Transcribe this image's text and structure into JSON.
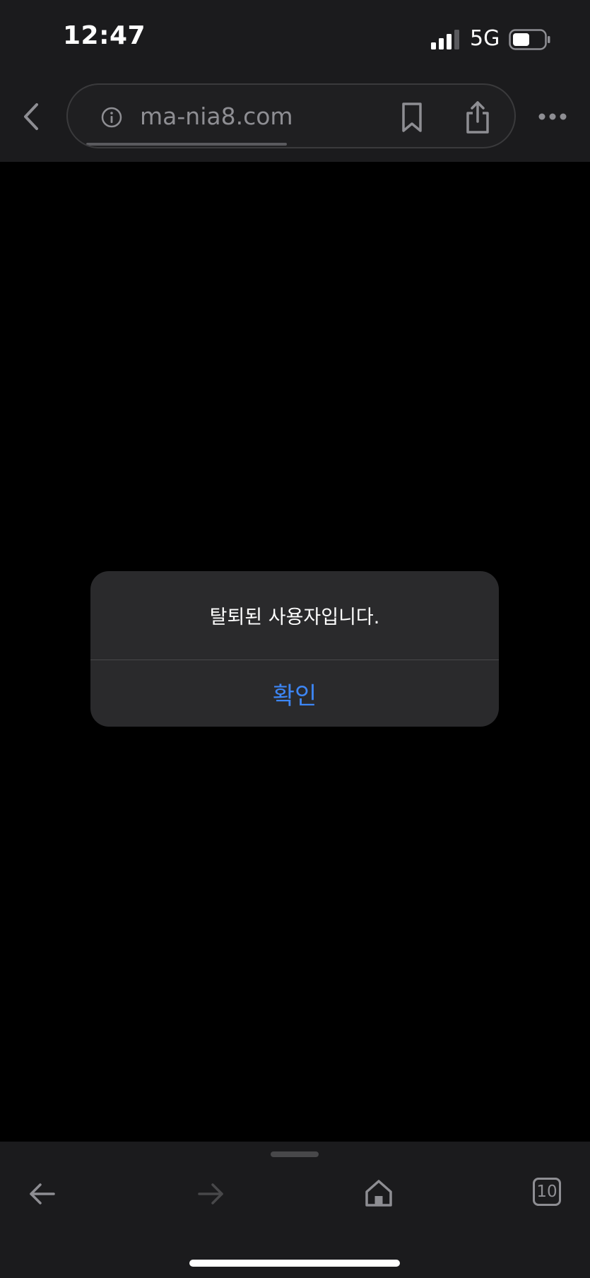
{
  "status_bar": {
    "time": "12:47",
    "network": "5G",
    "signal_icon": "cellular-signal-icon",
    "battery_icon": "battery-icon"
  },
  "browser": {
    "url": "ma-nia8.com",
    "load_progress": 0.49,
    "icons": {
      "back": "chevron-left-icon",
      "info": "info-icon",
      "bookmark": "bookmark-icon",
      "share": "share-icon",
      "more": "more-dots-icon"
    }
  },
  "alert": {
    "message": "탈퇴된 사용자입니다.",
    "confirm_label": "확인"
  },
  "toolbar": {
    "tab_count": "10",
    "icons": {
      "back": "arrow-left-icon",
      "forward": "arrow-right-icon",
      "home": "home-icon",
      "tabs": "tabs-icon"
    }
  },
  "colors": {
    "bar_background": "#1b1b1d",
    "dialog_background": "#2a2a2c",
    "accent": "#3d86f5",
    "icon_gray": "#8e8e93"
  }
}
